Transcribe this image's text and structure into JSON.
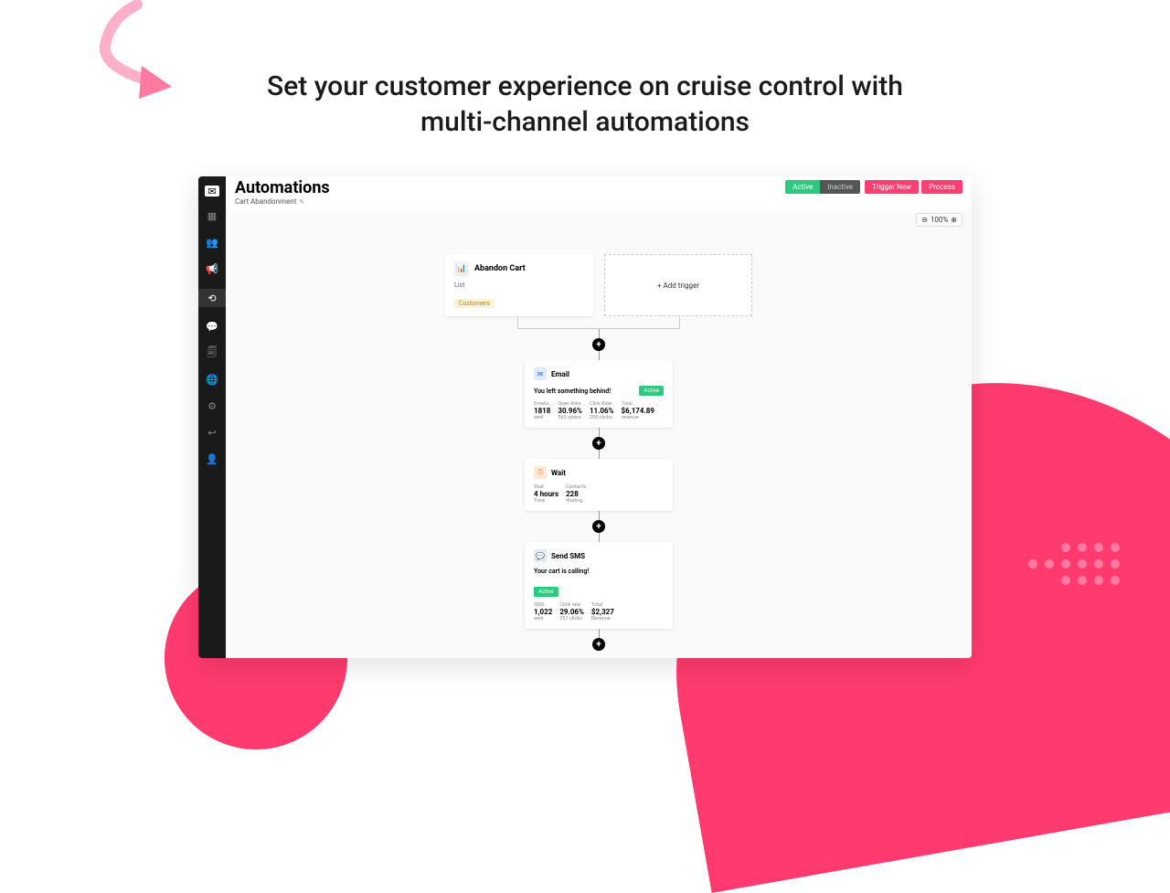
{
  "headline": "Set your customer experience on cruise control with multi-channel automations",
  "header": {
    "title": "Automations",
    "breadcrumb": "Cart Abandonment",
    "buttons": {
      "active": "Active",
      "inactive": "Inactive",
      "trigger_new": "Trigger New",
      "process": "Process"
    }
  },
  "zoom": {
    "value": "100%"
  },
  "trigger": {
    "title": "Abandon Cart",
    "sub_label": "List",
    "tag": "Customers",
    "add_label": "+ Add trigger"
  },
  "email_step": {
    "title": "Email",
    "subject": "You left something behind!",
    "badge": "Active",
    "stats": {
      "emails": {
        "label": "Emails",
        "value": "1818",
        "sub": "sent"
      },
      "open": {
        "label": "Open Rate",
        "value": "30.96%",
        "sub": "563 opens"
      },
      "click": {
        "label": "Click Rate",
        "value": "11.06%",
        "sub": "208 clicks"
      },
      "total": {
        "label": "Total",
        "value": "$6,174.89",
        "sub": "revenue"
      }
    }
  },
  "wait_step": {
    "title": "Wait",
    "stats": {
      "wait": {
        "label": "Wait",
        "value": "4 hours",
        "sub": "Time"
      },
      "contacts": {
        "label": "Contacts",
        "value": "228",
        "sub": "Waiting"
      }
    }
  },
  "sms_step": {
    "title": "Send SMS",
    "subject": "Your cart is calling!",
    "badge": "Active",
    "stats": {
      "sms": {
        "label": "SMS",
        "value": "1,022",
        "sub": "sent"
      },
      "click": {
        "label": "Click rate",
        "value": "29.06%",
        "sub": "297 clicks"
      },
      "total": {
        "label": "Total",
        "value": "$2,327",
        "sub": "Revenue"
      }
    }
  }
}
